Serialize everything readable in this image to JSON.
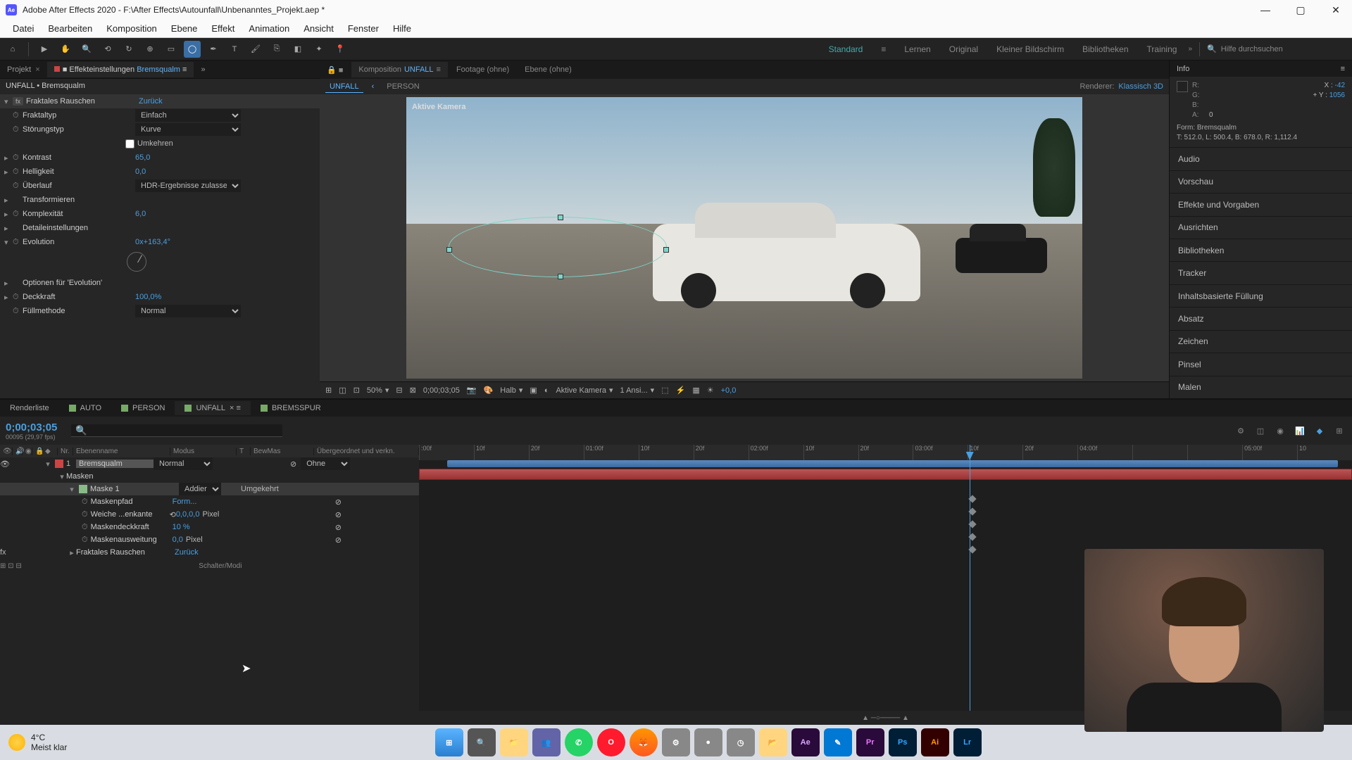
{
  "titlebar": {
    "app": "Ae",
    "title": "Adobe After Effects 2020 - F:\\After Effects\\Autounfall\\Unbenanntes_Projekt.aep *"
  },
  "menu": [
    "Datei",
    "Bearbeiten",
    "Komposition",
    "Ebene",
    "Effekt",
    "Animation",
    "Ansicht",
    "Fenster",
    "Hilfe"
  ],
  "workspaces": {
    "active": "Standard",
    "items": [
      "Lernen",
      "Original",
      "Kleiner Bildschirm",
      "Bibliotheken",
      "Training"
    ],
    "search_placeholder": "Hilfe durchsuchen"
  },
  "left_panel": {
    "tabs": {
      "project": "Projekt",
      "effect_controls": "Effekteinstellungen",
      "layer": "Bremsqualm"
    },
    "breadcrumb": "UNFALL • Bremsqualm",
    "effect": {
      "name": "Fraktales Rauschen",
      "reset": "Zurück",
      "props": {
        "fraktaltyp": {
          "label": "Fraktaltyp",
          "value": "Einfach"
        },
        "storungstyp": {
          "label": "Störungstyp",
          "value": "Kurve"
        },
        "umkehren": {
          "label": "Umkehren"
        },
        "kontrast": {
          "label": "Kontrast",
          "value": "65,0"
        },
        "helligkeit": {
          "label": "Helligkeit",
          "value": "0,0"
        },
        "uberlauf": {
          "label": "Überlauf",
          "value": "HDR-Ergebnisse zulasse"
        },
        "transformieren": {
          "label": "Transformieren"
        },
        "komplexitat": {
          "label": "Komplexität",
          "value": "6,0"
        },
        "detaileinstellungen": {
          "label": "Detaileinstellungen"
        },
        "evolution": {
          "label": "Evolution",
          "value": "0x+163,4°"
        },
        "evolution_opt": {
          "label": "Optionen für 'Evolution'"
        },
        "deckkraft": {
          "label": "Deckkraft",
          "value": "100,0%"
        },
        "fullmethode": {
          "label": "Füllmethode",
          "value": "Normal"
        }
      }
    }
  },
  "viewer": {
    "tabs": {
      "comp_prefix": "Komposition",
      "comp_name": "UNFALL",
      "footage": "Footage (ohne)",
      "ebene": "Ebene (ohne)"
    },
    "subtabs": {
      "unfall": "UNFALL",
      "person": "PERSON"
    },
    "renderer": {
      "label": "Renderer:",
      "value": "Klassisch 3D"
    },
    "cam_label": "Aktive Kamera",
    "footer": {
      "zoom": "50%",
      "timecode": "0;00;03;05",
      "res": "Halb",
      "camera": "Aktive Kamera",
      "views": "1 Ansi...",
      "exposure": "+0,0"
    }
  },
  "info": {
    "title": "Info",
    "rgba": {
      "r": "R:",
      "g": "G:",
      "b": "B:",
      "a": "A:",
      "a_val": "0"
    },
    "xy": {
      "x_label": "X :",
      "x_val": "-42",
      "y_label": "Y :",
      "y_val": "1056"
    },
    "shape": "Form: Bremsqualm",
    "bounds": "T: 512.0, L: 500.4, B: 678.0, R: 1,112.4"
  },
  "side_sections": [
    "Audio",
    "Vorschau",
    "Effekte und Vorgaben",
    "Ausrichten",
    "Bibliotheken",
    "Tracker",
    "Inhaltsbasierte Füllung",
    "Absatz",
    "Zeichen",
    "Pinsel",
    "Malen"
  ],
  "timeline": {
    "tabs": [
      "Renderliste",
      "AUTO",
      "PERSON",
      "UNFALL",
      "BREMSSPUR"
    ],
    "active_tab": 3,
    "timecode": "0;00;03;05",
    "timecode_sub": "00095 (29,97 fps)",
    "columns": {
      "nr": "Nr.",
      "name": "Ebenenname",
      "modus": "Modus",
      "t": "T",
      "bewmas": "BewMas",
      "parent": "Übergeordnet und verkn."
    },
    "layer": {
      "num": "1",
      "name": "Bremsqualm",
      "mode": "Normal",
      "parent": "Ohne",
      "masken": "Masken",
      "mask1": "Maske 1",
      "mask_mode": "Addieren",
      "mask_invert": "Umgekehrt",
      "maskenpfad": {
        "label": "Maskenpfad",
        "value": "Form..."
      },
      "weiche": {
        "label": "Weiche ...enkante",
        "value": "0,0,0,0",
        "unit": "Pixel"
      },
      "maskendeckkraft": {
        "label": "Maskendeckkraft",
        "value": "10  %"
      },
      "maskenausweitung": {
        "label": "Maskenausweitung",
        "value": "0,0",
        "unit": "Pixel"
      },
      "fraktales": {
        "label": "Fraktales Rauschen",
        "value": "Zurück"
      }
    },
    "ruler": [
      ":00f",
      "10f",
      "20f",
      "01:00f",
      "10f",
      "20f",
      "02:00f",
      "10f",
      "20f",
      "03:00f",
      "10f",
      "20f",
      "04:00f",
      "",
      "",
      "05:00f",
      "10"
    ],
    "footer": "Schalter/Modi"
  },
  "taskbar": {
    "weather": {
      "temp": "4°C",
      "desc": "Meist klar"
    }
  }
}
